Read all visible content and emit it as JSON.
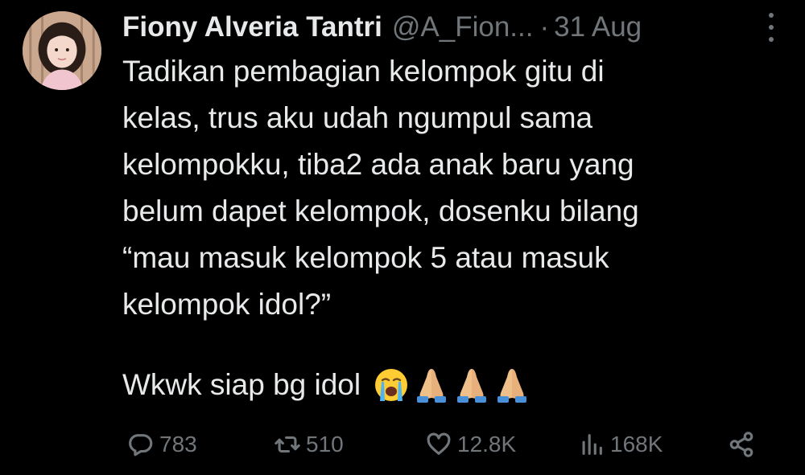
{
  "tweet": {
    "author_name": "Fiony Alveria Tantri",
    "author_handle": "@A_Fion...",
    "separator": "·",
    "date": "31 Aug",
    "text": "Tadikan pembagian kelompok gitu di\nkelas, trus aku udah ngumpul sama\nkelompokku, tiba2 ada anak baru yang\nbelum dapet kelompok, dosenku bilang\n“mau masuk kelompok 5 atau masuk\nkelompok idol?”",
    "last_line": "Wkwk siap bg idol",
    "emojis": [
      "loudly-crying-face",
      "folded-hands",
      "folded-hands",
      "folded-hands"
    ]
  },
  "actions": {
    "replies": "783",
    "retweets": "510",
    "likes": "12.8K",
    "views": "168K"
  },
  "colors": {
    "background": "#000000",
    "text": "#e7e9ea",
    "muted": "#71767b"
  }
}
